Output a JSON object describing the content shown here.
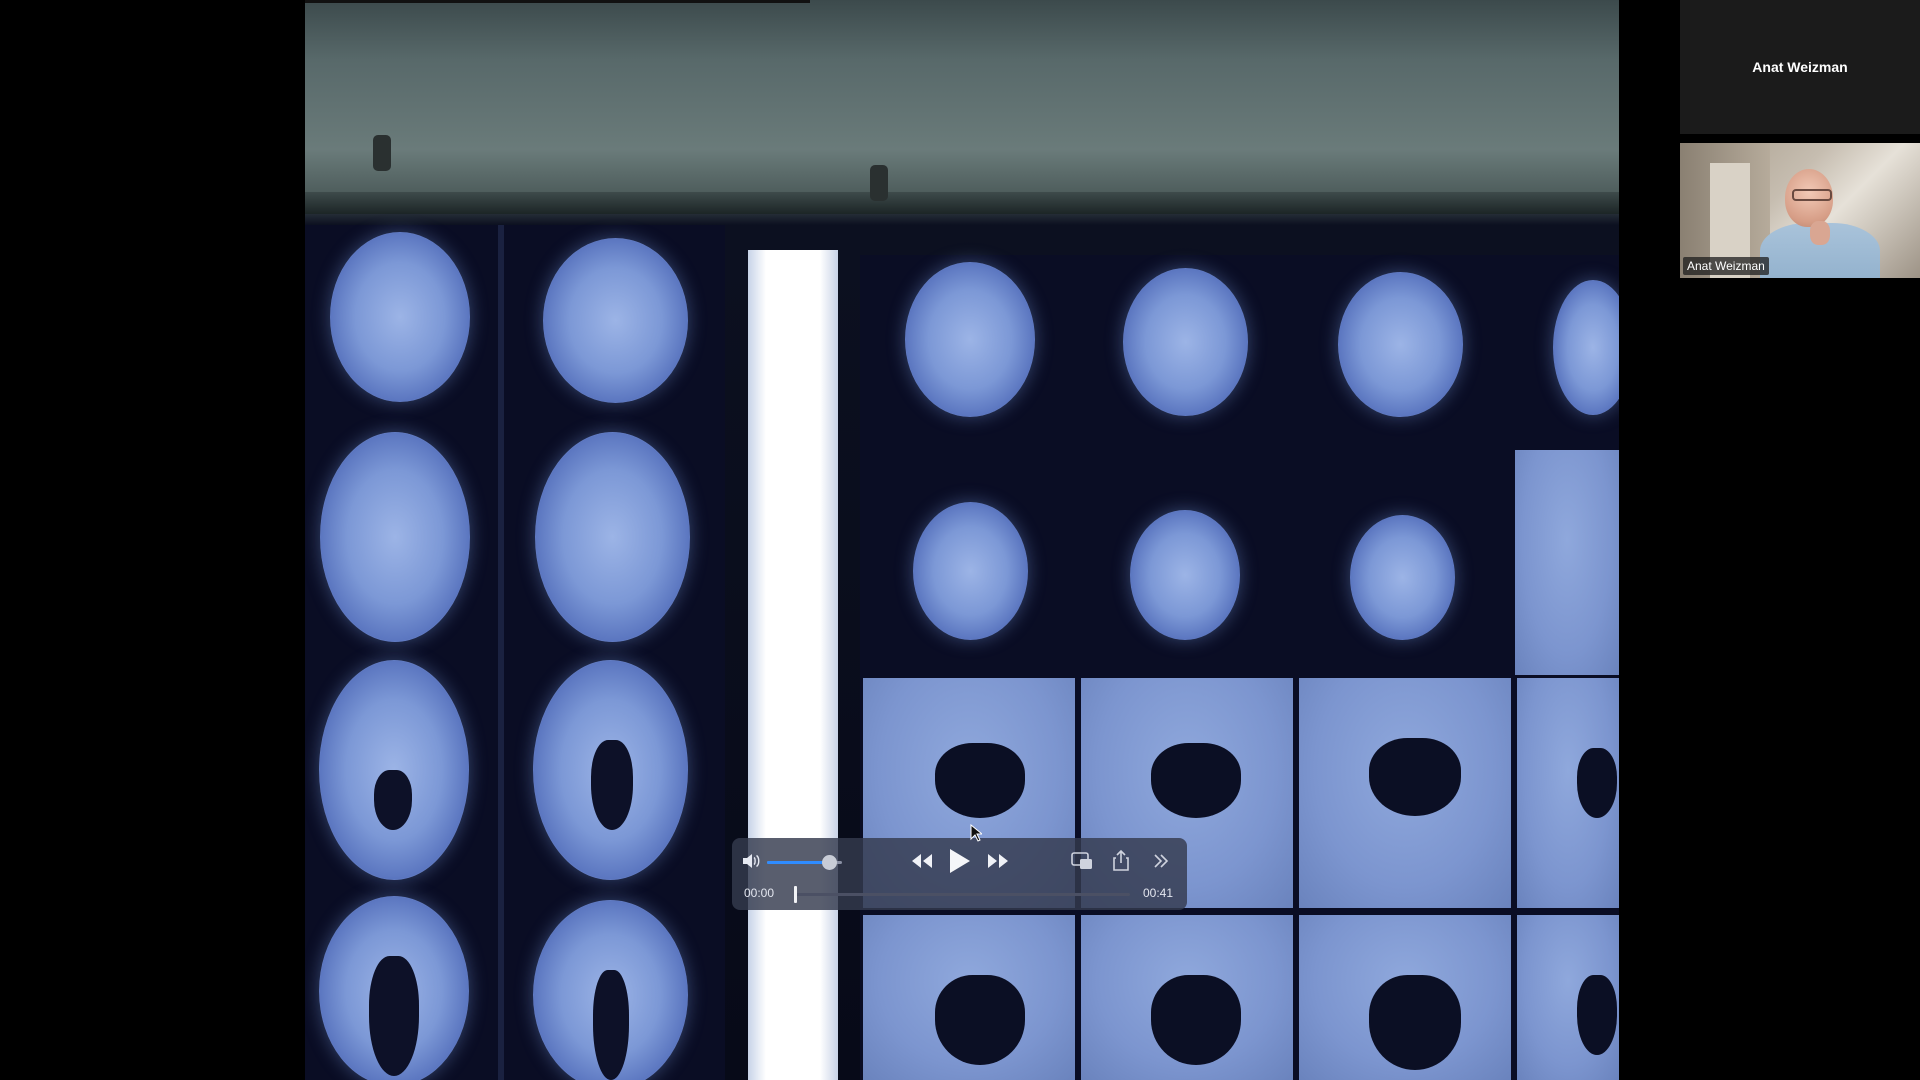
{
  "participants": {
    "speaker_tile_name": "Anat Weizman",
    "camera_label": "Anat Weizman"
  },
  "player": {
    "current_time": "00:00",
    "duration": "00:41",
    "volume_fraction": 0.82,
    "progress_fraction": 0.0,
    "icons": [
      "volume-icon",
      "rewind-icon",
      "play-icon",
      "fast-forward-icon",
      "picture-in-picture-icon",
      "share-icon",
      "more-chevrons-icon"
    ],
    "accent_color": "#2f8cff"
  },
  "colors": {
    "background": "#000000",
    "panel_tile": "#1b1b1b"
  }
}
